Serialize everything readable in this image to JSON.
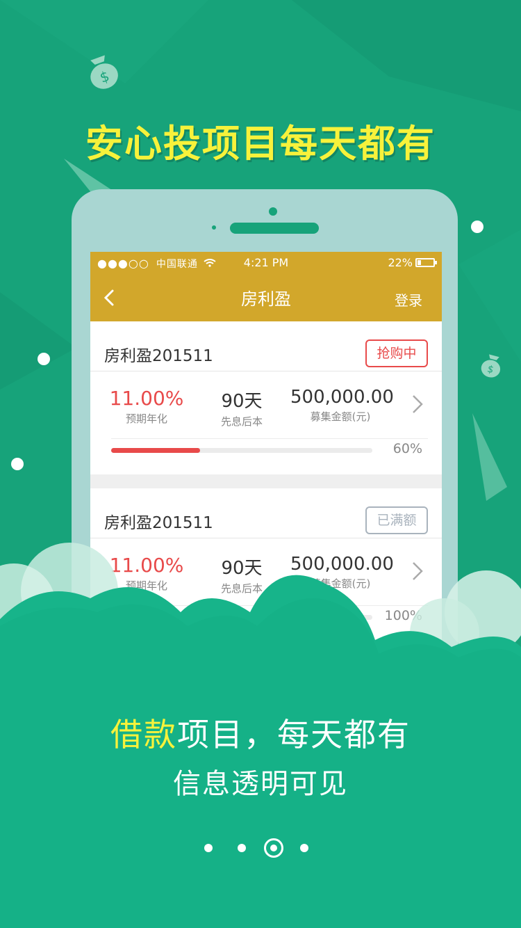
{
  "headline": "安心投项目每天都有",
  "status_bar": {
    "signal": "●●●○○",
    "carrier": "中国联通",
    "time": "4:21 PM",
    "battery": "22%",
    "battery_level": 0.22
  },
  "nav": {
    "title": "房利盈",
    "login_label": "登录"
  },
  "products": [
    {
      "name": "房利盈201511",
      "status": "抢购中",
      "rate": "11.00%",
      "rate_label": "预期年化",
      "term": "90天",
      "term_label": "先息后本",
      "amount": "500,000.00",
      "amount_label": "募集金额(元)",
      "progress_text": "60%",
      "progress": 0.6
    },
    {
      "name": "房利盈201511",
      "status": "已满额",
      "rate": "11.00%",
      "rate_label": "预期年化",
      "term": "90天",
      "term_label": "先息后本",
      "amount": "500,000.00",
      "amount_label": "募集金额(元)",
      "progress_text": "100%",
      "progress": 1.0
    }
  ],
  "tagline": {
    "highlight": "借款",
    "rest": "项目，每天都有",
    "line2": "信息透明可见"
  },
  "pager": {
    "count": 4,
    "active_index": 2
  },
  "colors": {
    "background": "#17a37a",
    "accent_yellow": "#f7f23b",
    "app_gold": "#d2a72b",
    "alert_red": "#e84a4a"
  }
}
